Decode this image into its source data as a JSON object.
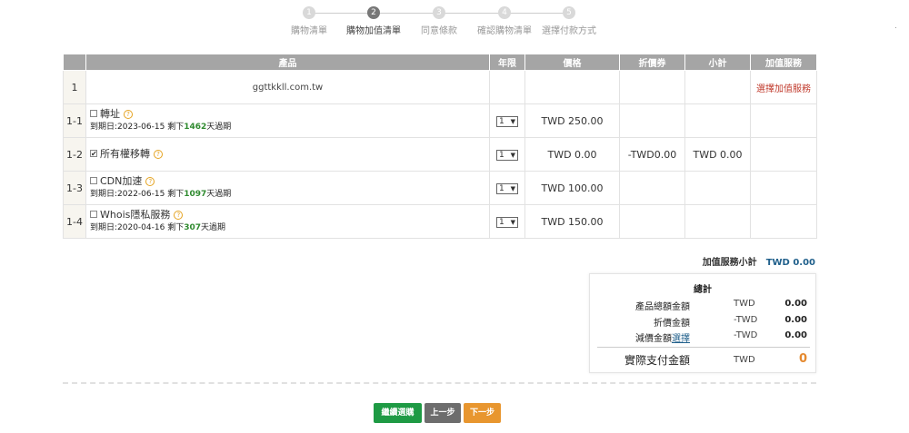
{
  "stepper": {
    "steps": [
      {
        "num": "1",
        "label": "購物清單"
      },
      {
        "num": "2",
        "label": "購物加值清單"
      },
      {
        "num": "3",
        "label": "同意條款"
      },
      {
        "num": "4",
        "label": "確認購物清單"
      },
      {
        "num": "5",
        "label": "選擇付款方式"
      }
    ],
    "active_index": 1
  },
  "table": {
    "headers": [
      "",
      "產品",
      "年限",
      "價格",
      "折價券",
      "小計",
      "加值服務"
    ],
    "domain_row": {
      "num": "1",
      "product": "ggttkkll.com.tw",
      "service_link": "選擇加值服務"
    },
    "rows": [
      {
        "num": "1-1",
        "name": "轉址",
        "checked": false,
        "expiry_prefix": "到期日:2023-06-15 剩下",
        "days": "1462",
        "expiry_suffix": "天過期",
        "years": "1",
        "price": "TWD  250.00",
        "coupon": "",
        "subtotal": ""
      },
      {
        "num": "1-2",
        "name": "所有權移轉",
        "checked": true,
        "expiry_prefix": "",
        "days": "",
        "expiry_suffix": "",
        "years": "1",
        "price": "TWD  0.00",
        "coupon": "-TWD0.00",
        "subtotal": "TWD  0.00"
      },
      {
        "num": "1-3",
        "name": "CDN加速",
        "checked": false,
        "expiry_prefix": "到期日:2022-06-15 剩下",
        "days": "1097",
        "expiry_suffix": "天過期",
        "years": "1",
        "price": "TWD  100.00",
        "coupon": "",
        "subtotal": ""
      },
      {
        "num": "1-4",
        "name": "Whois隱私服務",
        "checked": false,
        "expiry_prefix": "到期日:2020-04-16 剩下",
        "days": "307",
        "expiry_suffix": "天過期",
        "years": "1",
        "price": "TWD  150.00",
        "coupon": "",
        "subtotal": ""
      }
    ]
  },
  "subtotal": {
    "label": "加值服務小計",
    "value": "TWD 0.00"
  },
  "summary": {
    "title": "總計",
    "rows": [
      {
        "label": "產品總額金額",
        "currency": "TWD",
        "amount": "0.00"
      },
      {
        "label": "折價金額",
        "currency": "-TWD",
        "amount": "0.00"
      },
      {
        "label": "減價金額",
        "link": "選擇",
        "currency": "-TWD",
        "amount": "0.00"
      }
    ],
    "final": {
      "label": "實際支付金額",
      "currency": "TWD",
      "amount": "0"
    }
  },
  "buttons": {
    "continue": "繼續選購",
    "prev": "上一步",
    "next": "下一步"
  },
  "colors": {
    "header_bg": "#a5a5a5",
    "days_green": "#2f8a2f",
    "link_red": "#c0392b",
    "final_orange": "#e5892e",
    "btn_green": "#1e9a44",
    "btn_gray": "#6d6d6d",
    "btn_orange": "#e8962f"
  }
}
